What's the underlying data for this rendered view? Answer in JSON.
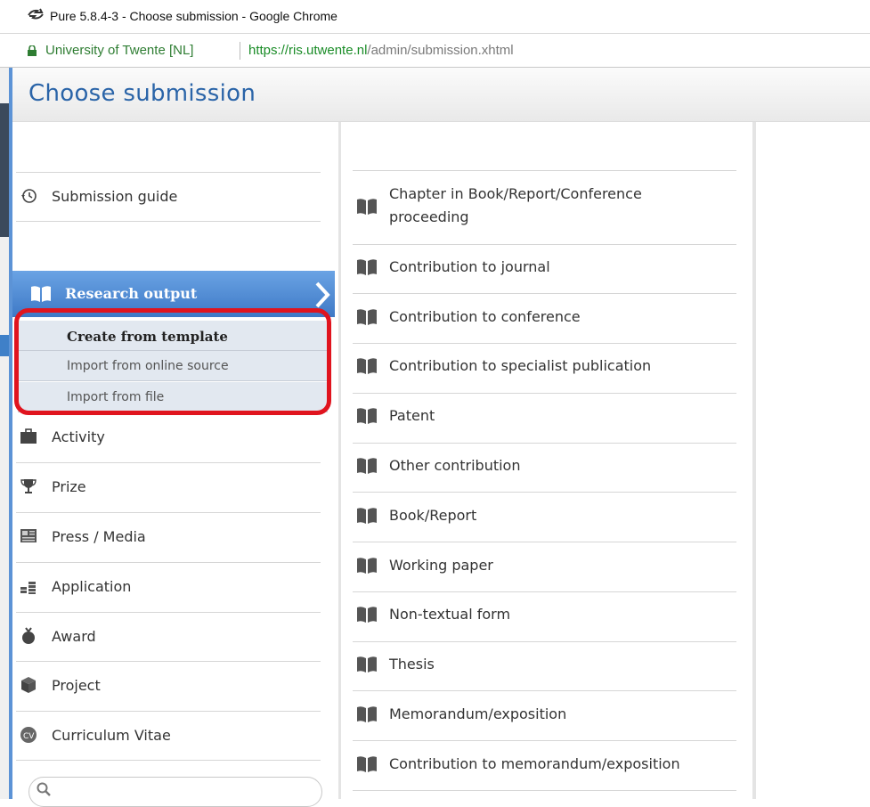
{
  "window": {
    "title": "Pure 5.8.4-3 - Choose submission - Google Chrome",
    "site_label": "University of Twente [NL]",
    "url_scheme": "https://",
    "url_host": "ris.utwente.nl",
    "url_path": "/admin/submission.xhtml"
  },
  "header": {
    "title": "Choose submission"
  },
  "menu": {
    "submission_guide": "Submission guide",
    "research_output": "Research output",
    "submenu": [
      "Create from template",
      "Import from online source",
      "Import from file"
    ],
    "items": [
      "Activity",
      "Prize",
      "Press / Media",
      "Application",
      "Award",
      "Project",
      "Curriculum Vitae"
    ],
    "search_placeholder": ""
  },
  "submission_types": [
    "Chapter in Book/Report/Conference proceeding",
    "Contribution to journal",
    "Contribution to conference",
    "Contribution to specialist publication",
    "Patent",
    "Other contribution",
    "Book/Report",
    "Working paper",
    "Non-textual form",
    "Thesis",
    "Memorandum/exposition",
    "Contribution to memorandum/exposition"
  ],
  "colors": {
    "accent": "#2a64a8",
    "menu_selected": "#3e79c6",
    "highlight_border": "#e0141e",
    "secure_green": "#2e7d32"
  },
  "icons": {
    "browser": "chrome-app-icon",
    "lock": "lock-icon",
    "submission_guide": "history-clock-icon",
    "research_output": "open-book-icon",
    "activity": "briefcase-icon",
    "prize": "trophy-icon",
    "press_media": "newspaper-icon",
    "application": "coins-icon",
    "award": "medal-icon",
    "project": "cube-icon",
    "cv": "cv-badge-icon",
    "search": "search-icon"
  }
}
